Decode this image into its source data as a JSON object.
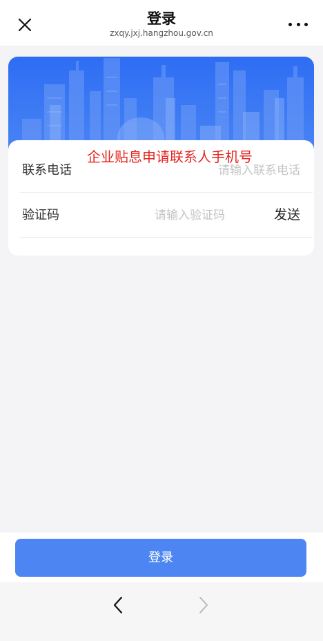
{
  "navbar": {
    "title": "登录",
    "subtitle": "zxqy.jxj.hangzhou.gov.cn",
    "close_icon": "close-icon",
    "more_icon": "more-icon"
  },
  "annotation": "企业贴息申请联系人手机号",
  "form": {
    "phone_label": "联系电话",
    "phone_placeholder": "请输入联系电话",
    "code_label": "验证码",
    "code_placeholder": "请输入验证码",
    "send_label": "发送"
  },
  "login_button": "登录",
  "browser_nav": {
    "back_icon": "chevron-left-icon",
    "forward_icon": "chevron-right-icon"
  },
  "colors": {
    "banner": "#2e6df3",
    "login_button": "#4d86f2",
    "annotation": "#e5251f"
  }
}
